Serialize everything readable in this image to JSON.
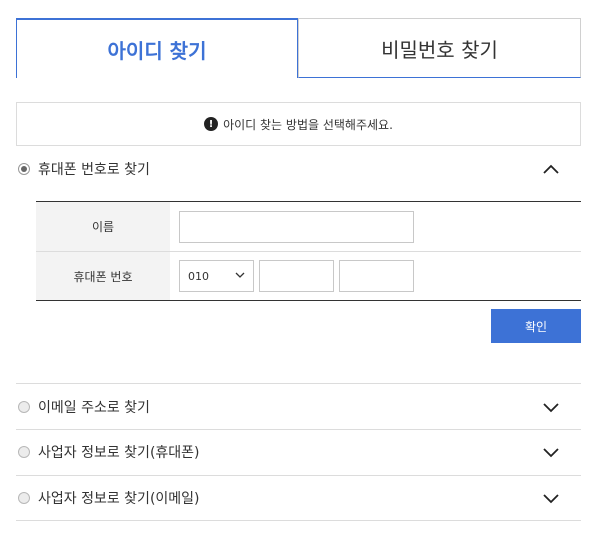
{
  "tabs": [
    {
      "label": "아이디 찾기",
      "active": true
    },
    {
      "label": "비밀번호 찾기",
      "active": false
    }
  ],
  "notice": {
    "icon": "exclamation-icon",
    "text": "아이디 찾는 방법을 선택해주세요."
  },
  "methods": [
    {
      "label": "휴대폰 번호로 찾기",
      "selected": true,
      "expanded": true
    },
    {
      "label": "이메일 주소로 찾기",
      "selected": false,
      "expanded": false
    },
    {
      "label": "사업자 정보로 찾기(휴대폰)",
      "selected": false,
      "expanded": false
    },
    {
      "label": "사업자 정보로 찾기(이메일)",
      "selected": false,
      "expanded": false
    }
  ],
  "form": {
    "name_label": "이름",
    "name_value": "",
    "phone_label": "휴대폰 번호",
    "phone_prefix": "010",
    "phone_middle": "",
    "phone_last": ""
  },
  "confirm_label": "확인",
  "colors": {
    "accent": "#3d72d6"
  }
}
